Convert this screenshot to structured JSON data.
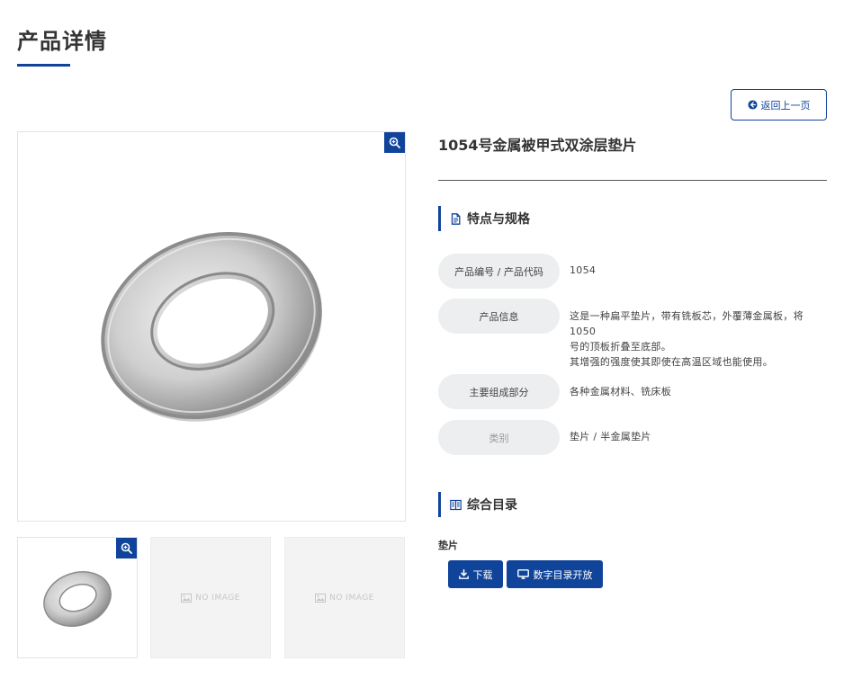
{
  "page": {
    "title": "产品详情",
    "back_label": "返回上一页"
  },
  "product": {
    "name": "1054号金属被甲式双涂层垫片",
    "images": {
      "no_image_label": "NO IMAGE"
    }
  },
  "specs": {
    "heading": "特点与规格",
    "rows": [
      {
        "label": "产品编号 / 产品代码",
        "value": "1054"
      },
      {
        "label": "产品信息",
        "value_lines": [
          "这是一种扁平垫片，带有铣板芯，外覆薄金属板，将1050",
          "号的顶板折叠至底部。",
          "其增强的强度使其即使在高温区域也能使用。"
        ]
      },
      {
        "label": "主要组成部分",
        "value": "各种金属材料、铣床板"
      },
      {
        "label": "类别",
        "value": "垫片 / 半金属垫片"
      }
    ]
  },
  "catalog": {
    "heading": "综合目录",
    "item_label": "垫片",
    "download_label": "下载",
    "digital_label": "数字目录开放"
  },
  "colors": {
    "accent": "#10449a",
    "pill_bg": "#eceeef",
    "text": "#333333"
  },
  "icons": [
    "zoom-icon",
    "arrow-left-circle-icon",
    "document-icon",
    "book-icon",
    "download-icon",
    "monitor-icon",
    "image-placeholder-icon"
  ]
}
